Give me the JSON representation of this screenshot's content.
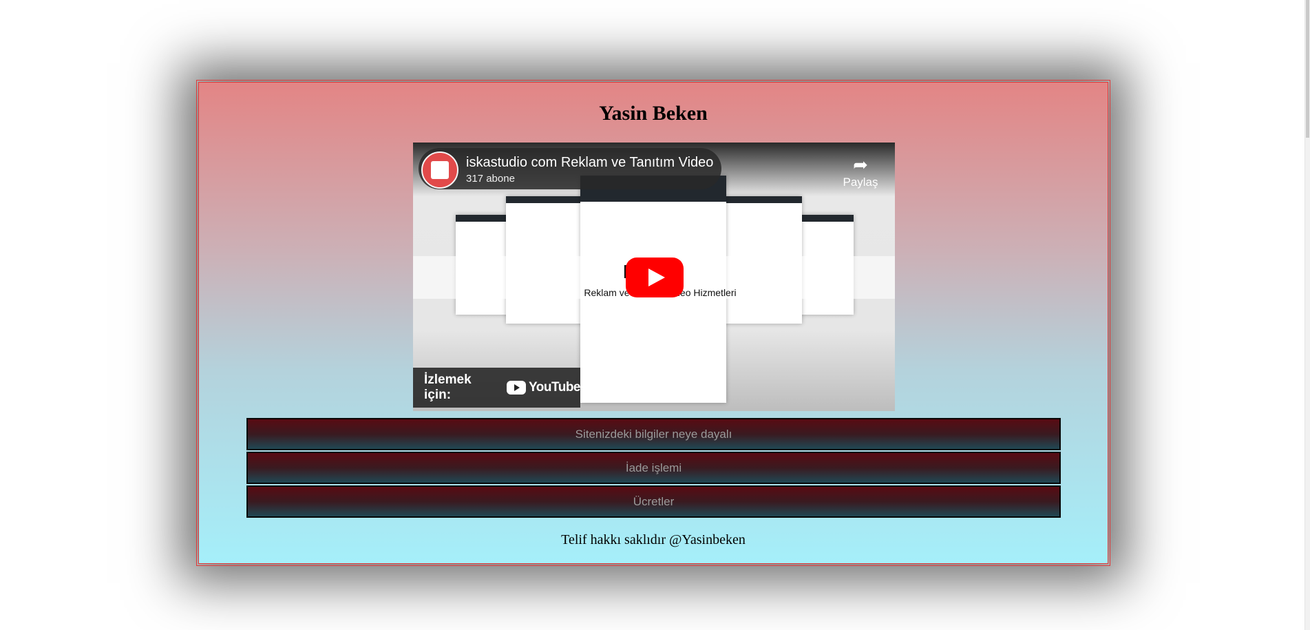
{
  "page": {
    "title": "Yasin Beken"
  },
  "video": {
    "channel_title": "iskastudio com Reklam ve Tanıtım Video",
    "subscribers": "317 abone",
    "share_label": "Paylaş",
    "watch_on_label": "İzlemek için:",
    "youtube_label": "YouTube",
    "thumbnail_heading": "Reklam ve Tanıtım Video Hizmetleri",
    "thumbnail_logo": "IO"
  },
  "accordion": {
    "items": [
      {
        "label": "Sitenizdeki bilgiler neye dayalı"
      },
      {
        "label": "İade işlemi"
      },
      {
        "label": "Ücretler"
      }
    ]
  },
  "footer": {
    "copyright": "Telif hakkı saklıdır @Yasinbeken"
  },
  "colors": {
    "border": "#e03a3a",
    "youtube_red": "#ff0000",
    "button_text": "#9a9a9a"
  }
}
